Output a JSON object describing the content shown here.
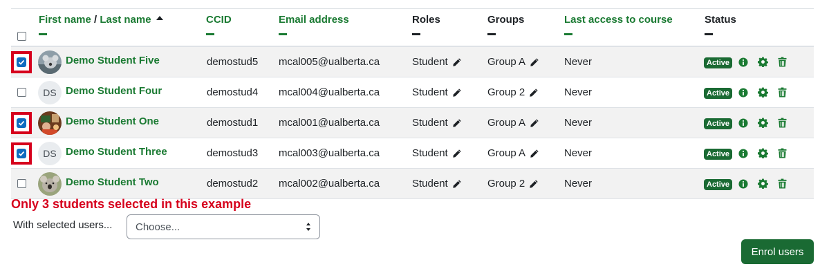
{
  "header": {
    "first_name": "First name",
    "separator": " / ",
    "last_name": "Last name",
    "ccid": "CCID",
    "email": "Email address",
    "roles": "Roles",
    "groups": "Groups",
    "last_access": "Last access to course",
    "status": "Status"
  },
  "rows": [
    {
      "selected": true,
      "avatar": "photo",
      "initials": "",
      "name": "Demo Student Five",
      "ccid": "demostud5",
      "email": "mcal005@ualberta.ca",
      "role": "Student",
      "group": "Group A",
      "last_access": "Never",
      "status": "Active"
    },
    {
      "selected": false,
      "avatar": "initials",
      "initials": "DS",
      "name": "Demo Student Four",
      "ccid": "demostud4",
      "email": "mcal004@ualberta.ca",
      "role": "Student",
      "group": "Group 2",
      "last_access": "Never",
      "status": "Active"
    },
    {
      "selected": true,
      "avatar": "photo",
      "initials": "",
      "name": "Demo Student One",
      "ccid": "demostud1",
      "email": "mcal001@ualberta.ca",
      "role": "Student",
      "group": "Group A",
      "last_access": "Never",
      "status": "Active"
    },
    {
      "selected": true,
      "avatar": "initials",
      "initials": "DS",
      "name": "Demo Student Three",
      "ccid": "demostud3",
      "email": "mcal003@ualberta.ca",
      "role": "Student",
      "group": "Group A",
      "last_access": "Never",
      "status": "Active"
    },
    {
      "selected": false,
      "avatar": "photo",
      "initials": "",
      "name": "Demo Student Two",
      "ccid": "demostud2",
      "email": "mcal002@ualberta.ca",
      "role": "Student",
      "group": "Group 2",
      "last_access": "Never",
      "status": "Active"
    }
  ],
  "note": "Only 3 students selected in this example",
  "bulk": {
    "label": "With selected users...",
    "selected": "Choose..."
  },
  "enrol_button": "Enrol users",
  "icons": {
    "edit": "pencil-icon",
    "info": "info-icon",
    "settings": "gear-icon",
    "delete": "trash-icon",
    "sort": "sort-asc-icon"
  },
  "colors": {
    "link": "#1a7a32",
    "badge": "#1a6a33",
    "highlight": "#d6001c",
    "checkbox": "#0f6cbf",
    "stripe": "#f2f2f2"
  }
}
